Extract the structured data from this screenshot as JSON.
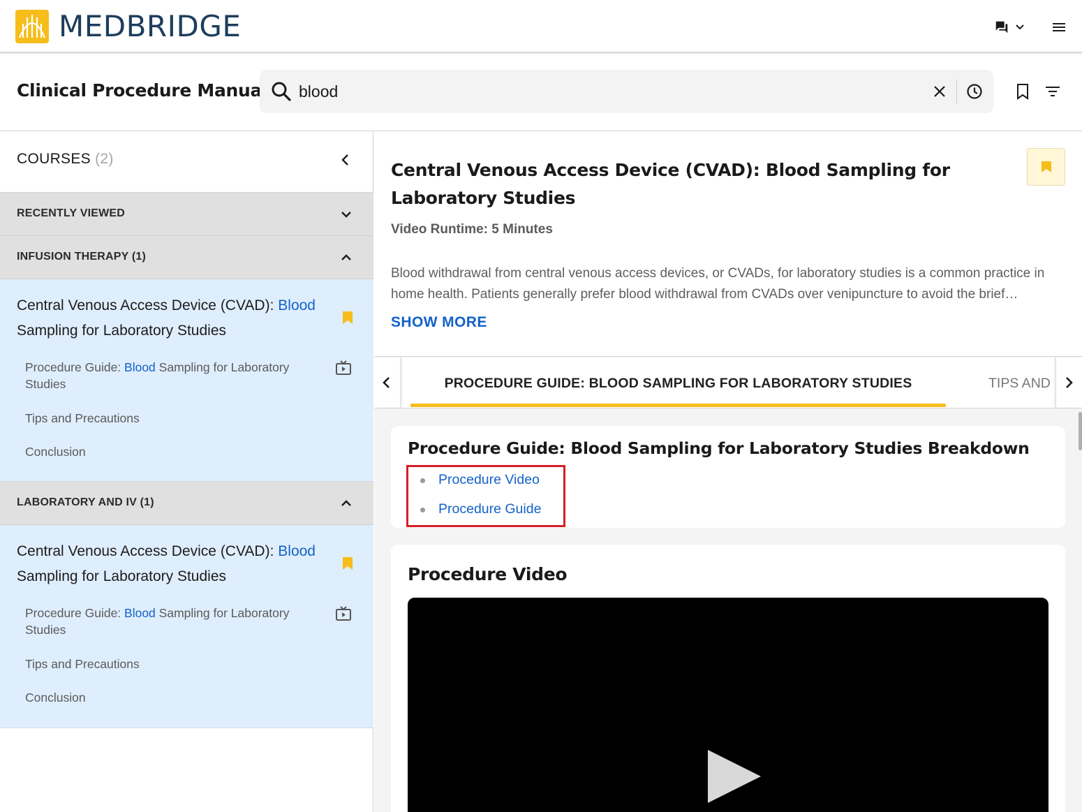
{
  "app": {
    "brand": "MEDBRIDGE",
    "colors": {
      "accent": "#f6bd1b",
      "link": "#1362c9",
      "selected_bg": "#dfeefd",
      "highlight_box": "#d41f26"
    }
  },
  "topbar": {
    "chat_icon": "chat-bubbles-icon",
    "menu_icon": "hamburger-menu-icon"
  },
  "header": {
    "title": "Clinical Procedure Manual",
    "search": {
      "value": "blood",
      "placeholder": ""
    }
  },
  "sidebar": {
    "courses_label": "COURSES",
    "courses_count": "(2)",
    "sections": [
      {
        "label": "RECENTLY VIEWED",
        "expanded": false
      },
      {
        "label": "INFUSION THERAPY (1)",
        "expanded": true,
        "course": {
          "title_pre": "Central Venous Access Device (CVAD): ",
          "title_hl": "Blood",
          "title_post": " Sampling for Laboratory Studies",
          "sub1_pre": "Procedure Guide: ",
          "sub1_hl": "Blood",
          "sub1_post": " Sampling for Laboratory Studies",
          "sub2": "Tips and Precautions",
          "sub3": "Conclusion"
        }
      },
      {
        "label": "LABORATORY AND IV (1)",
        "expanded": true,
        "course": {
          "title_pre": "Central Venous Access Device (CVAD): ",
          "title_hl": "Blood",
          "title_post": " Sampling for Laboratory Studies",
          "sub1_pre": "Procedure Guide: ",
          "sub1_hl": "Blood",
          "sub1_post": " Sampling for Laboratory Studies",
          "sub2": "Tips and Precautions",
          "sub3": "Conclusion"
        }
      }
    ]
  },
  "detail": {
    "title": "Central Venous Access Device (CVAD): Blood Sampling for Laboratory Studies",
    "runtime": "Video Runtime: 5 Minutes",
    "description": "Blood withdrawal from central venous access devices, or CVADs, for laboratory studies is a common practice in home health. Patients generally prefer blood withdrawal from CVADs over venipuncture to avoid the brief…",
    "show_more": "SHOW MORE"
  },
  "tabs": {
    "active": "PROCEDURE GUIDE: BLOOD SAMPLING FOR LABORATORY STUDIES",
    "next": "TIPS AND"
  },
  "breakdown": {
    "title": "Procedure Guide: Blood Sampling for Laboratory Studies Breakdown",
    "links": [
      "Procedure Video",
      "Procedure Guide"
    ]
  },
  "video": {
    "title": "Procedure Video"
  }
}
